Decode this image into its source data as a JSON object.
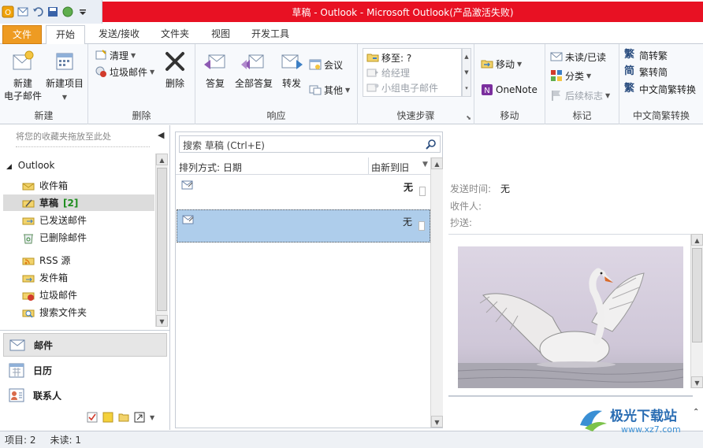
{
  "window": {
    "title": "草稿 - Outlook  -  Microsoft Outlook(产品激活失败)"
  },
  "ribbon": {
    "tabs": [
      {
        "label": "文件"
      },
      {
        "label": "开始"
      },
      {
        "label": "发送/接收"
      },
      {
        "label": "文件夹"
      },
      {
        "label": "视图"
      },
      {
        "label": "开发工具"
      }
    ],
    "groups": {
      "new": {
        "label": "新建",
        "new_email": "新建\n电子邮件",
        "new_email_1": "新建",
        "new_email_2": "电子邮件",
        "new_items": "新建项目"
      },
      "delete": {
        "label": "删除",
        "clean_up": "清理",
        "junk": "垃圾邮件",
        "delete": "删除"
      },
      "respond": {
        "label": "响应",
        "reply": "答复",
        "reply_all": "全部答复",
        "forward": "转发",
        "meeting": "会议",
        "more": "其他"
      },
      "quick_steps": {
        "label": "快速步骤",
        "move_to": "移至: ?",
        "to_manager": "给经理",
        "team_email": "小组电子邮件"
      },
      "move": {
        "label": "移动",
        "move": "移动",
        "onenote": "OneNote"
      },
      "tags": {
        "label": "标记",
        "read_unread": "未读/已读",
        "categorize": "分类",
        "follow_up": "后续标志"
      },
      "chinese_conversion": {
        "label": "中文简繁转换",
        "to_traditional": "简转繁",
        "to_simplified": "繁转简",
        "conversion": "中文简繁转换"
      }
    }
  },
  "nav": {
    "favorites_hint": "将您的收藏夹拖放至此处",
    "root": "Outlook",
    "folders": [
      {
        "label": "收件箱",
        "icon": "inbox-icon"
      },
      {
        "label": "草稿",
        "count": "[2]",
        "icon": "drafts-icon",
        "selected": true
      },
      {
        "label": "已发送邮件",
        "icon": "sent-icon"
      },
      {
        "label": "已删除邮件",
        "icon": "deleted-icon"
      },
      {
        "label": "RSS 源",
        "icon": "rss-icon"
      },
      {
        "label": "发件箱",
        "icon": "outbox-icon"
      },
      {
        "label": "垃圾邮件",
        "icon": "junk-icon"
      },
      {
        "label": "搜索文件夹",
        "icon": "search-folder-icon"
      }
    ],
    "buttons": [
      {
        "label": "邮件",
        "icon": "mail-icon",
        "selected": true
      },
      {
        "label": "日历",
        "icon": "calendar-icon"
      },
      {
        "label": "联系人",
        "icon": "contacts-icon"
      }
    ]
  },
  "list": {
    "search_placeholder": "搜索 草稿 (Ctrl+E)",
    "sort_by": "排列方式: 日期",
    "sort_order": "由新到旧",
    "messages": [
      {
        "value": "无",
        "selected": false
      },
      {
        "value": "无",
        "selected": true
      }
    ]
  },
  "reading": {
    "sent_label": "发送时间:",
    "sent_value": "无",
    "to_label": "收件人:",
    "cc_label": "抄送:"
  },
  "status": {
    "items": "项目: 2",
    "unread": "未读: 1"
  },
  "watermark": {
    "brand": "极光下载站",
    "url": "www.xz7.com"
  },
  "colors": {
    "title_bar": "#e81123",
    "file_tab": "#ee9b22",
    "selection": "#aecdeb",
    "count_green": "#1e8d1e"
  }
}
